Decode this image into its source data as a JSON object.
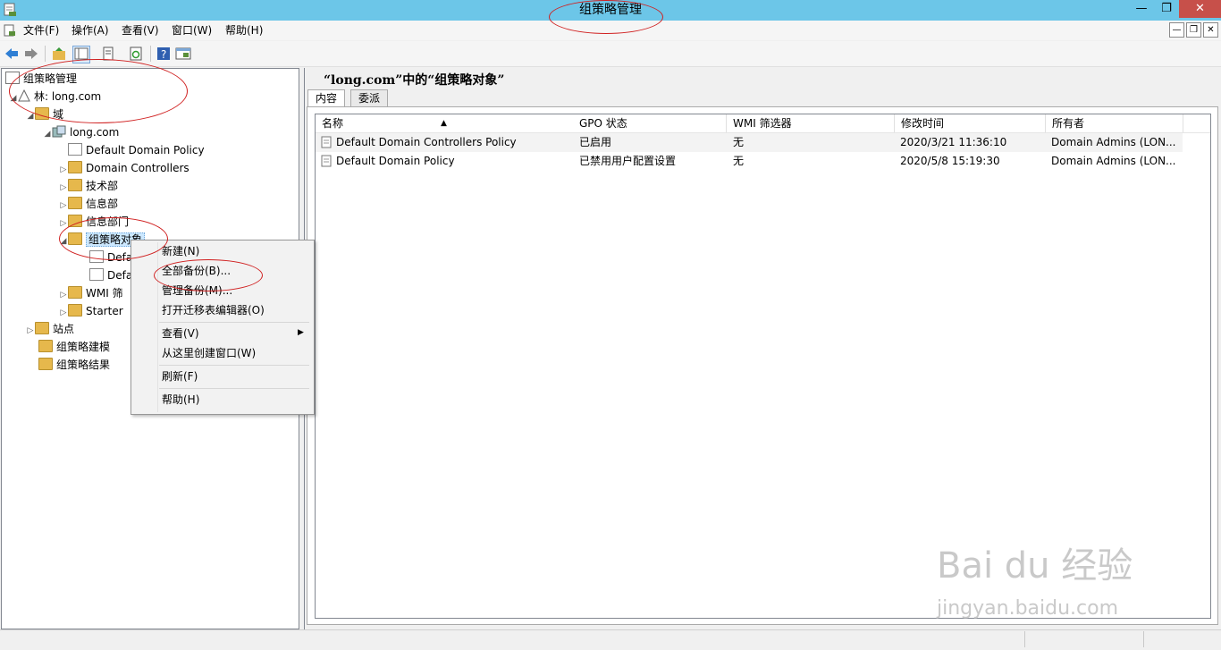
{
  "window": {
    "title": "组策略管理"
  },
  "menubar": {
    "items": [
      "文件(F)",
      "操作(A)",
      "查看(V)",
      "窗口(W)",
      "帮助(H)"
    ]
  },
  "tree": {
    "root": "组策略管理",
    "forest": "林: long.com",
    "domains": "域",
    "domain": "long.com",
    "items": {
      "default_domain_policy": "Default Domain Policy",
      "domain_controllers": "Domain Controllers",
      "tech_dept": "技术部",
      "info_dept": "信息部",
      "info_dept2": "信息部门",
      "gpo_objects": "组策略对象",
      "gpo_child1": "Defa",
      "gpo_child2": "Defa",
      "wmi_filters": "WMI 筛",
      "starter": "Starter"
    },
    "sites": "站点",
    "modeling": "组策略建模",
    "results": "组策略结果"
  },
  "right": {
    "title": "“long.com”中的“组策略对象”",
    "tabs": [
      "内容",
      "委派"
    ],
    "columns": [
      "名称",
      "GPO 状态",
      "WMI 筛选器",
      "修改时间",
      "所有者"
    ],
    "rows": [
      {
        "name": "Default Domain Controllers Policy",
        "status": "已启用",
        "wmi": "无",
        "modified": "2020/3/21 11:36:10",
        "owner": "Domain Admins (LON..."
      },
      {
        "name": "Default Domain Policy",
        "status": "已禁用用户配置设置",
        "wmi": "无",
        "modified": "2020/5/8 15:19:30",
        "owner": "Domain Admins (LON..."
      }
    ]
  },
  "context_menu": {
    "new": "新建(N)",
    "backup_all": "全部备份(B)...",
    "manage_backups": "管理备份(M)...",
    "open_migration": "打开迁移表编辑器(O)",
    "view": "查看(V)",
    "new_window": "从这里创建窗口(W)",
    "refresh": "刷新(F)",
    "help": "帮助(H)"
  },
  "watermark": {
    "main": "Bai du 经验",
    "sub": "jingyan.baidu.com"
  },
  "colors": {
    "titlebar": "#6cc6e8",
    "close": "#c7504a",
    "annotation": "#d02020"
  }
}
